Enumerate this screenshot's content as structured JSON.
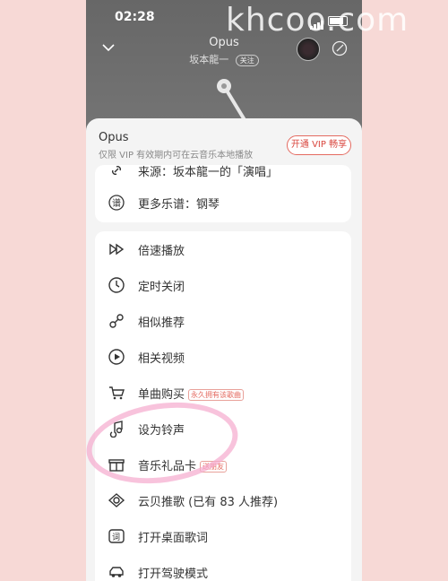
{
  "status_bar": {
    "time": "02:28"
  },
  "watermark": "khcoo.com",
  "header": {
    "song_title": "Opus",
    "artist": "坂本龍一",
    "follow_label": "关注"
  },
  "vip_banner": {
    "title": "Opus",
    "description": "仅限 VIP 有效期内可在云音乐本地播放",
    "button_label": "开通 VIP 畅享"
  },
  "top_items": [
    {
      "label": "来源：坂本龍一的「演唱」",
      "icon": "link-icon"
    },
    {
      "label": "更多乐谱：钢琴",
      "icon": "score-icon"
    }
  ],
  "menu_items": [
    {
      "label": "倍速播放",
      "icon": "speed-icon",
      "tag": ""
    },
    {
      "label": "定时关闭",
      "icon": "clock-icon",
      "tag": ""
    },
    {
      "label": "相似推荐",
      "icon": "similar-icon",
      "tag": ""
    },
    {
      "label": "相关视频",
      "icon": "video-icon",
      "tag": ""
    },
    {
      "label": "单曲购买",
      "icon": "cart-icon",
      "tag": "永久拥有该歌曲"
    },
    {
      "label": "设为铃声",
      "icon": "ringtone-icon",
      "tag": ""
    },
    {
      "label": "音乐礼品卡",
      "icon": "gift-icon",
      "tag": "送朋友"
    },
    {
      "label": "云贝推歌 (已有 83 人推荐)",
      "icon": "cloud-coin-icon",
      "tag": ""
    },
    {
      "label": "打开桌面歌词",
      "icon": "lyrics-icon",
      "tag": ""
    },
    {
      "label": "打开驾驶模式",
      "icon": "car-icon",
      "tag": ""
    }
  ],
  "colors": {
    "accent": "#e46a60",
    "highlight_circle": "#f5aacd"
  }
}
